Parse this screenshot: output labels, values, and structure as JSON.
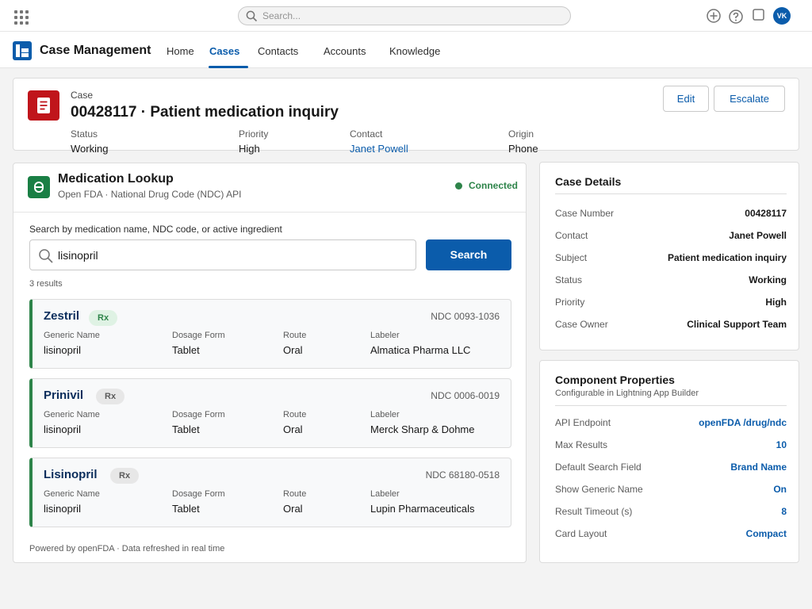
{
  "global": {
    "search_placeholder": "Search...",
    "avatar_initials": "VK",
    "icons": [
      "app-launcher-icon",
      "search-icon",
      "add-icon",
      "help-icon",
      "notifications-icon"
    ]
  },
  "app": {
    "name": "Case Management",
    "tabs": [
      {
        "label": "Home",
        "active": false
      },
      {
        "label": "Cases",
        "active": true
      },
      {
        "label": "Contacts",
        "active": false
      },
      {
        "label": "Accounts",
        "active": false
      },
      {
        "label": "Knowledge",
        "active": false
      }
    ]
  },
  "case": {
    "object_label": "Case",
    "title": "00428117 · Patient medication inquiry",
    "buttons": {
      "edit": "Edit",
      "escalate": "Escalate"
    },
    "fields": [
      {
        "label": "Status",
        "value": "Working"
      },
      {
        "label": "Priority",
        "value": "High"
      },
      {
        "label": "Contact",
        "value": "Janet Powell"
      },
      {
        "label": "Origin",
        "value": "Phone"
      }
    ]
  },
  "medication": {
    "title": "Medication Lookup",
    "subtitle": "Open FDA · National Drug Code (NDC) API",
    "status": "Connected",
    "status_color": "#2e844a",
    "search_label": "Search by medication name, NDC code, or active ingredient",
    "search_value": "lisinopril",
    "search_button": "Search",
    "result_count": "3 results",
    "column_labels": {
      "generic": "Generic Name",
      "form": "Dosage Form",
      "route": "Route",
      "labeler": "Labeler"
    },
    "results": [
      {
        "name": "Zestril",
        "badge": "Rx",
        "ndc": "NDC 0093-1036",
        "generic": "lisinopril",
        "form": "Tablet",
        "route": "Oral",
        "labeler": "Almatica Pharma LLC"
      },
      {
        "name": "Prinivil",
        "badge": "Rx",
        "ndc": "NDC 0006-0019",
        "generic": "lisinopril",
        "form": "Tablet",
        "route": "Oral",
        "labeler": "Merck Sharp & Dohme"
      },
      {
        "name": "Lisinopril",
        "badge": "Rx",
        "ndc": "NDC 68180-0518",
        "generic": "lisinopril",
        "form": "Tablet",
        "route": "Oral",
        "labeler": "Lupin Pharmaceuticals"
      }
    ],
    "footer": "Powered by openFDA · Data refreshed in real time"
  },
  "case_details": {
    "title": "Case Details",
    "rows": [
      {
        "label": "Case Number",
        "value": "00428117"
      },
      {
        "label": "Contact",
        "value": "Janet Powell"
      },
      {
        "label": "Subject",
        "value": "Patient medication inquiry"
      },
      {
        "label": "Status",
        "value": "Working"
      },
      {
        "label": "Priority",
        "value": "High"
      },
      {
        "label": "Case Owner",
        "value": "Clinical Support Team"
      }
    ]
  },
  "component_properties": {
    "title": "Component Properties",
    "subtitle": "Configurable in Lightning App Builder",
    "rows": [
      {
        "label": "API Endpoint",
        "value": "openFDA /drug/ndc"
      },
      {
        "label": "Max Results",
        "value": "10"
      },
      {
        "label": "Default Search Field",
        "value": "Brand Name"
      },
      {
        "label": "Show Generic Name",
        "value": "On"
      },
      {
        "label": "Result Timeout (s)",
        "value": "8"
      },
      {
        "label": "Card Layout",
        "value": "Compact"
      }
    ]
  },
  "colors": {
    "brand": "#0b5cab",
    "case_icon": "#c0151b",
    "rx_green": "#2e844a"
  }
}
